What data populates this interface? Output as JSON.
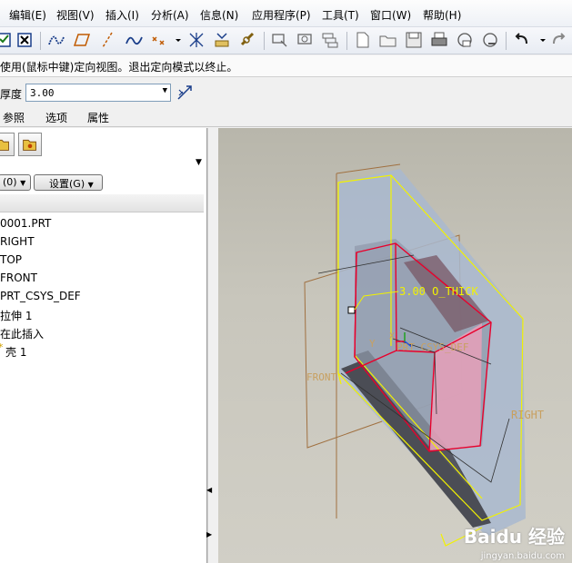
{
  "menu": [
    "编辑(E)",
    "视图(V)",
    "插入(I)",
    "分析(A)",
    "信息(N)",
    "应用程序(P)",
    "工具(T)",
    "窗口(W)",
    "帮助(H)"
  ],
  "message": "使用(鼠标中键)定向视图。退出定向模式以终止。",
  "dashboard": {
    "thickness_label": "厚度",
    "thickness_value": "3.00"
  },
  "tabs": [
    "参照",
    "选项",
    "属性"
  ],
  "panel": {
    "filter_left": "(0)",
    "settings": "设置(G)"
  },
  "tree": [
    "0001.PRT",
    "RIGHT",
    "TOP",
    "FRONT",
    "PRT_CSYS_DEF",
    "拉伸 1",
    "在此插入",
    "壳 1"
  ],
  "viewport": {
    "dimension_label": "3.00 O_THICK",
    "csys_label": "PRT_CSYS_DEF",
    "y_label": "Y",
    "x_label": "X",
    "front_label": "FRONT",
    "right_label": "RIGHT",
    "watermark": "Baidu 经验",
    "watermark_url": "jingyan.baidu.com"
  },
  "colors": {
    "datum_yellow": "#f2f200",
    "red_edge": "#e8002c",
    "datum_label": "#c8a060",
    "part_blue": "#aab8cc",
    "part_dark": "#4d4f57"
  }
}
